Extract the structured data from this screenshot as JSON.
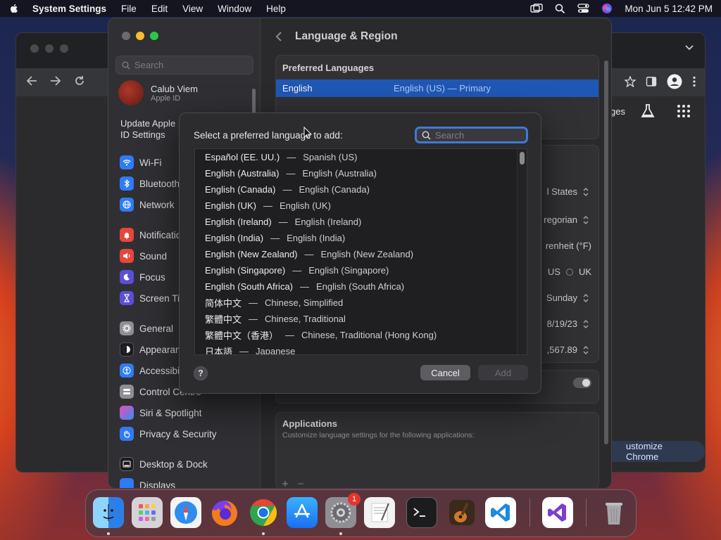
{
  "menubar": {
    "app_name": "System Settings",
    "items": [
      "File",
      "Edit",
      "View",
      "Window",
      "Help"
    ],
    "clock": "Mon Jun 5  12:42 PM"
  },
  "chrome": {
    "partial_label": "ges",
    "customize_label": "ustomize Chrome"
  },
  "settings": {
    "search_placeholder": "Search",
    "account": {
      "name": "Calub Viem",
      "subtitle": "Apple ID"
    },
    "update_notice": "Update Apple ID Settings",
    "sidebar": [
      {
        "label": "Wi-Fi",
        "icon": "wifi-icon",
        "color": "#2f7bf5"
      },
      {
        "label": "Bluetooth",
        "icon": "bluetooth-icon",
        "color": "#2f7bf5"
      },
      {
        "label": "Network",
        "icon": "globe-icon",
        "color": "#2f7bf5"
      },
      {
        "label": "Notifications",
        "icon": "bell-icon",
        "color": "#e6463c"
      },
      {
        "label": "Sound",
        "icon": "speaker-icon",
        "color": "#e6463c"
      },
      {
        "label": "Focus",
        "icon": "moon-icon",
        "color": "#5b4fd6"
      },
      {
        "label": "Screen Time",
        "icon": "hourglass-icon",
        "color": "#5b4fd6"
      },
      {
        "label": "General",
        "icon": "gear-icon",
        "color": "#8e8e93"
      },
      {
        "label": "Appearance",
        "icon": "appearance-icon",
        "color": "#1c1c1e"
      },
      {
        "label": "Accessibility",
        "icon": "accessibility-icon",
        "color": "#2f7bf5"
      },
      {
        "label": "Control Centre",
        "icon": "control-centre-icon",
        "color": "#8e8e93"
      },
      {
        "label": "Siri & Spotlight",
        "icon": "siri-icon",
        "color": "#c43ad6"
      },
      {
        "label": "Privacy & Security",
        "icon": "hand-icon",
        "color": "#2f7bf5"
      },
      {
        "label": "Desktop & Dock",
        "icon": "dock-icon",
        "color": "#1c1c1e"
      },
      {
        "label": "Displays",
        "icon": "display-icon",
        "color": "#2f7bf5"
      }
    ],
    "main": {
      "title": "Language & Region",
      "preferred_title": "Preferred Languages",
      "primary_language": "English",
      "primary_language_detail": "English (US) — Primary",
      "region_value": "l States",
      "calendar_value": "regorian",
      "temperature_value": "renheit (°F)",
      "measurement_us": "US",
      "measurement_uk": "UK",
      "first_day_value": "Sunday",
      "date_format_value": "8/19/23",
      "number_format_value": ",567.89",
      "applications_title": "Applications",
      "applications_subtitle": "Customize language settings for the following applications:"
    }
  },
  "dialog": {
    "prompt": "Select a preferred language to add:",
    "search_placeholder": "Search",
    "languages": [
      {
        "native": "Español (EE. UU.)",
        "english": "Spanish (US)"
      },
      {
        "native": "English (Australia)",
        "english": "English (Australia)"
      },
      {
        "native": "English (Canada)",
        "english": "English (Canada)"
      },
      {
        "native": "English (UK)",
        "english": "English (UK)"
      },
      {
        "native": "English (Ireland)",
        "english": "English (Ireland)"
      },
      {
        "native": "English (India)",
        "english": "English (India)"
      },
      {
        "native": "English (New Zealand)",
        "english": "English (New Zealand)"
      },
      {
        "native": "English (Singapore)",
        "english": "English (Singapore)"
      },
      {
        "native": "English (South Africa)",
        "english": "English (South Africa)"
      },
      {
        "native": "简体中文",
        "english": "Chinese, Simplified"
      },
      {
        "native": "繁體中文",
        "english": "Chinese, Traditional"
      },
      {
        "native": "繁體中文（香港）",
        "english": "Chinese, Traditional (Hong Kong)"
      },
      {
        "native": "日本語",
        "english": "Japanese"
      }
    ],
    "separator": "—",
    "help_label": "?",
    "cancel_label": "Cancel",
    "add_label": "Add"
  },
  "dock": {
    "apps": [
      "Finder",
      "Launchpad",
      "Safari",
      "Firefox",
      "Google Chrome",
      "App Store",
      "System Settings",
      "TextEdit",
      "Terminal",
      "GarageBand",
      "Visual Studio Code",
      "Visual Studio",
      "Trash"
    ],
    "system_settings_badge": "1"
  }
}
